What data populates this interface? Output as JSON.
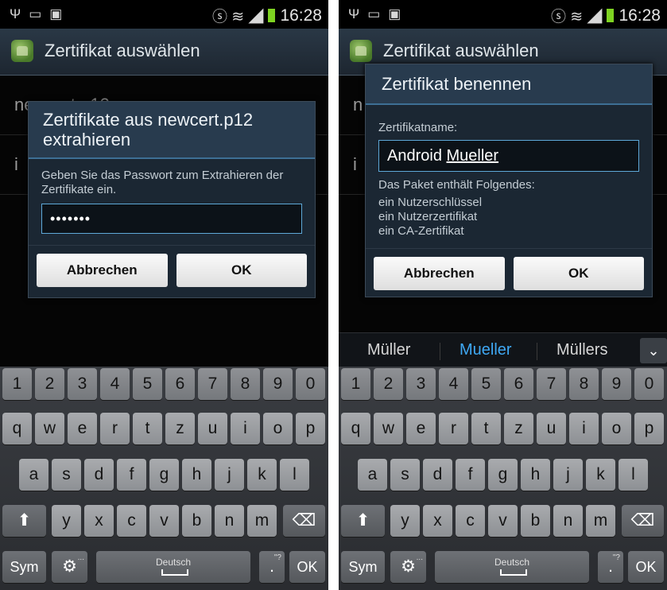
{
  "status": {
    "time": "16:28"
  },
  "left": {
    "title": "Zertifikat auswählen",
    "bg_items": [
      "newcert.p12",
      "i"
    ],
    "dialog": {
      "title": "Zertifikate aus newcert.p12 extrahieren",
      "message": "Geben Sie das Passwort zum Extrahieren der Zertifikate ein.",
      "password_value": "•••••••",
      "cancel": "Abbrechen",
      "ok": "OK"
    }
  },
  "right": {
    "title": "Zertifikat auswählen",
    "bg_items": [
      "n",
      "i"
    ],
    "dialog": {
      "title": "Zertifikat benennen",
      "name_label": "Zertifikatname:",
      "name_value_plain": "Android ",
      "name_value_underlined": "Mueller",
      "contains_label": "Das Paket enthält Folgendes:",
      "contents": [
        "ein Nutzerschlüssel",
        "ein Nutzerzertifikat",
        "ein CA-Zertifikat"
      ],
      "cancel": "Abbrechen",
      "ok": "OK"
    },
    "suggestions": [
      "Müller",
      "Mueller",
      "Müllers"
    ],
    "active_suggestion_color": "#3fa9f5"
  },
  "keyboard": {
    "numbers": [
      "1",
      "2",
      "3",
      "4",
      "5",
      "6",
      "7",
      "8",
      "9",
      "0"
    ],
    "row1": [
      "q",
      "w",
      "e",
      "r",
      "t",
      "z",
      "u",
      "i",
      "o",
      "p"
    ],
    "row2": [
      "a",
      "s",
      "d",
      "f",
      "g",
      "h",
      "j",
      "k",
      "l"
    ],
    "row3": [
      "y",
      "x",
      "c",
      "v",
      "b",
      "n",
      "m"
    ],
    "sym": "Sym",
    "language": "Deutsch",
    "period": ".",
    "ok": "OK",
    "small_hints": [
      "...",
      "\"?"
    ]
  }
}
